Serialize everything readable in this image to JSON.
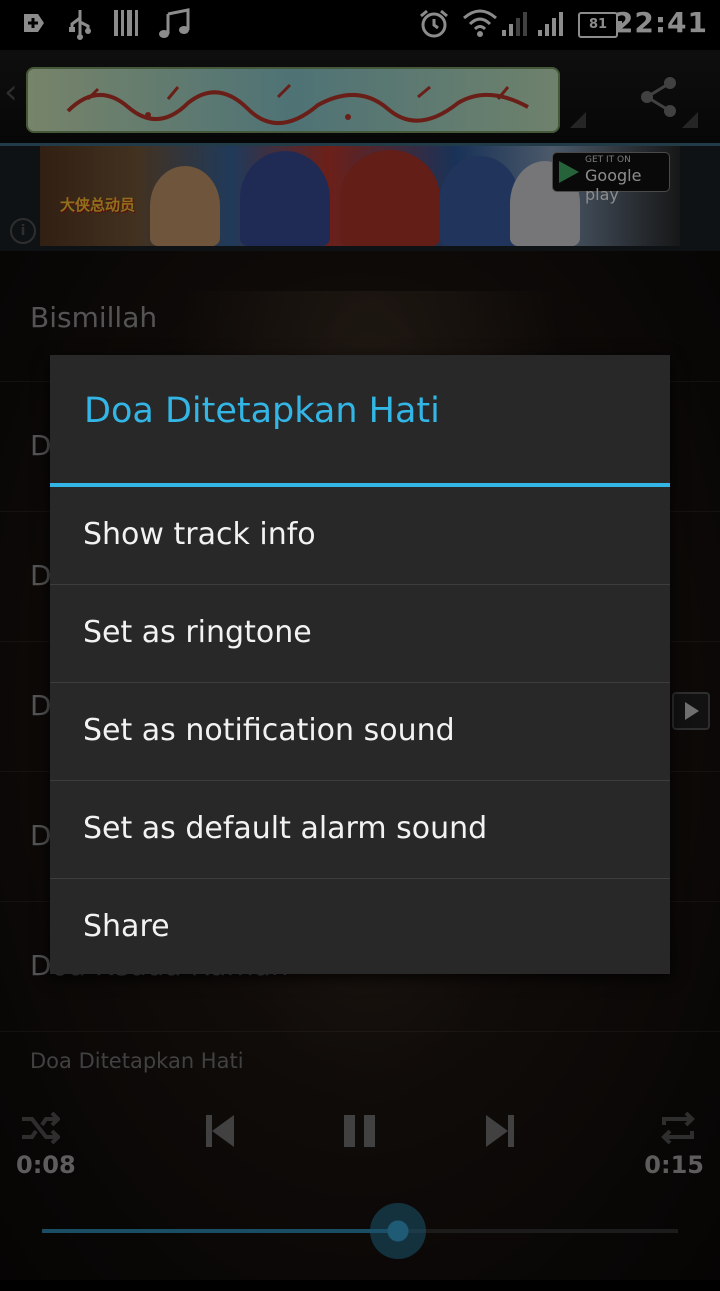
{
  "status_bar": {
    "time": "22:41",
    "battery": "81",
    "icons": [
      "add-notification-icon",
      "usb-icon",
      "barcode-icon",
      "music-note-icon",
      "alarm-icon",
      "wifi-icon",
      "signal-1-icon",
      "signal-2-icon"
    ]
  },
  "app_bar": {
    "logo_alt": "بسم الله الرحمن الرحيم",
    "share_icon": "share-icon"
  },
  "ad": {
    "badge_small": "GET IT ON",
    "badge_big": "Google play",
    "logo_text": "大侠总动员"
  },
  "list": {
    "items": [
      {
        "label": "Bismillah"
      },
      {
        "label": "D"
      },
      {
        "label": "D"
      },
      {
        "label": "D"
      },
      {
        "label": "D"
      },
      {
        "label": "Doa Kedua Rumah"
      }
    ]
  },
  "player": {
    "now_playing": "Doa Ditetapkan Hati",
    "elapsed": "0:08",
    "duration": "0:15",
    "progress": 0.56
  },
  "dialog": {
    "title": "Doa Ditetapkan Hati",
    "items": [
      {
        "label": "Show track info"
      },
      {
        "label": "Set as ringtone"
      },
      {
        "label": "Set as notification sound"
      },
      {
        "label": "Set as default alarm sound"
      },
      {
        "label": "Share"
      }
    ]
  },
  "colors": {
    "accent": "#33b5e5",
    "dialog_bg": "#282828",
    "seek": "#2f8fb8"
  }
}
